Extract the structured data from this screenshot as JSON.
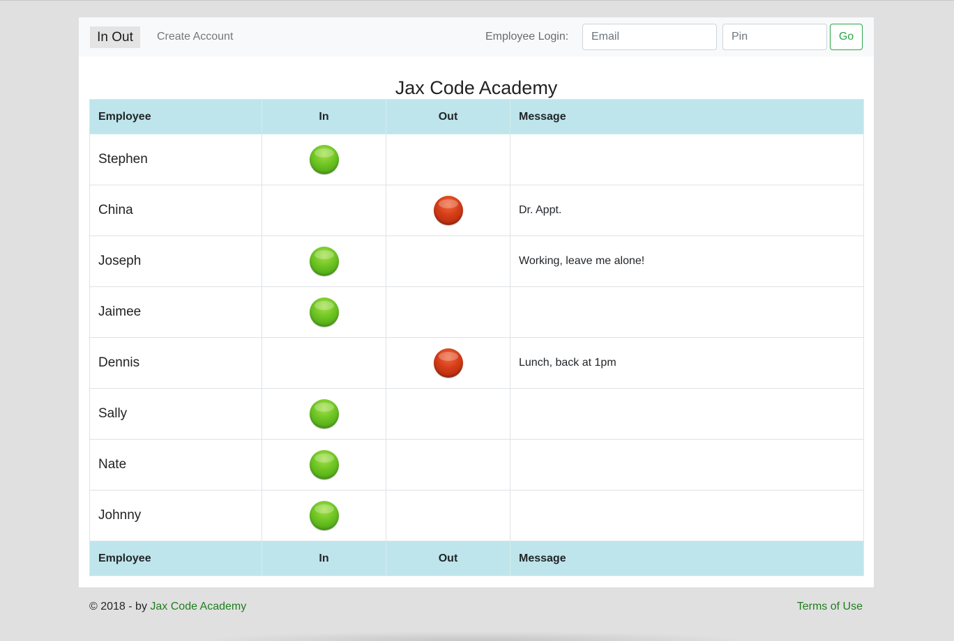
{
  "navbar": {
    "brand": "In Out",
    "create_account": "Create Account",
    "login_label": "Employee Login:",
    "email_placeholder": "Email",
    "pin_placeholder": "Pin",
    "go_label": "Go"
  },
  "title": "Jax Code Academy",
  "table": {
    "headers": {
      "employee": "Employee",
      "in": "In",
      "out": "Out",
      "message": "Message"
    },
    "rows": [
      {
        "name": "Stephen",
        "status": "in",
        "message": ""
      },
      {
        "name": "China",
        "status": "out",
        "message": "Dr. Appt."
      },
      {
        "name": "Joseph",
        "status": "in",
        "message": "Working, leave me alone!"
      },
      {
        "name": "Jaimee",
        "status": "in",
        "message": ""
      },
      {
        "name": "Dennis",
        "status": "out",
        "message": "Lunch, back at 1pm"
      },
      {
        "name": "Sally",
        "status": "in",
        "message": ""
      },
      {
        "name": "Nate",
        "status": "in",
        "message": ""
      },
      {
        "name": "Johnny",
        "status": "in",
        "message": ""
      }
    ]
  },
  "status_colors": {
    "in": "#6ec422",
    "out": "#d43c17"
  },
  "footer": {
    "copyright": "© 2018 - by ",
    "link": "Jax Code Academy",
    "terms": "Terms of Use"
  }
}
